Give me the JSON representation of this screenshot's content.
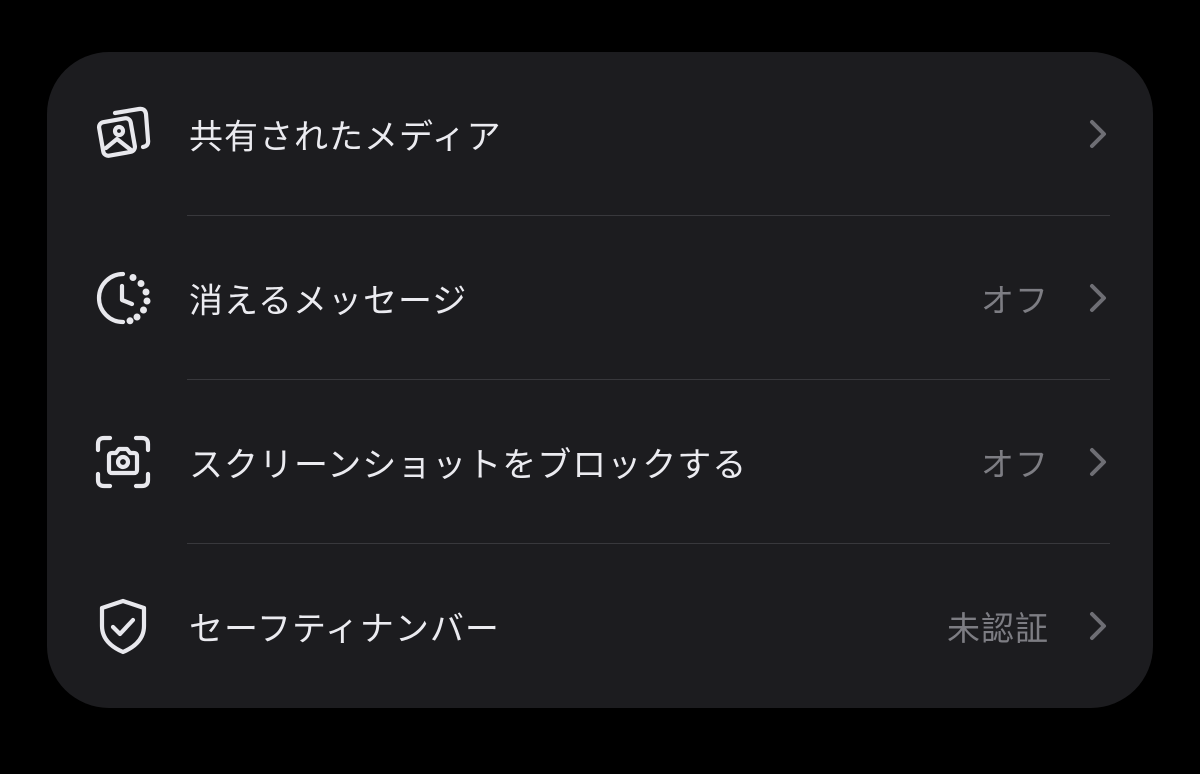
{
  "settings": {
    "items": [
      {
        "label": "共有されたメディア",
        "value": "",
        "icon": "shared-media-icon"
      },
      {
        "label": "消えるメッセージ",
        "value": "オフ",
        "icon": "disappearing-timer-icon"
      },
      {
        "label": "スクリーンショットをブロックする",
        "value": "オフ",
        "icon": "screenshot-camera-icon"
      },
      {
        "label": "セーフティナンバー",
        "value": "未認証",
        "icon": "shield-check-icon"
      }
    ]
  },
  "colors": {
    "background": "#000000",
    "card": "#1c1c1f",
    "label_text": "#ebebf0",
    "value_text": "#7d7d83",
    "chevron": "#6e6e74",
    "divider": "#38383c"
  }
}
